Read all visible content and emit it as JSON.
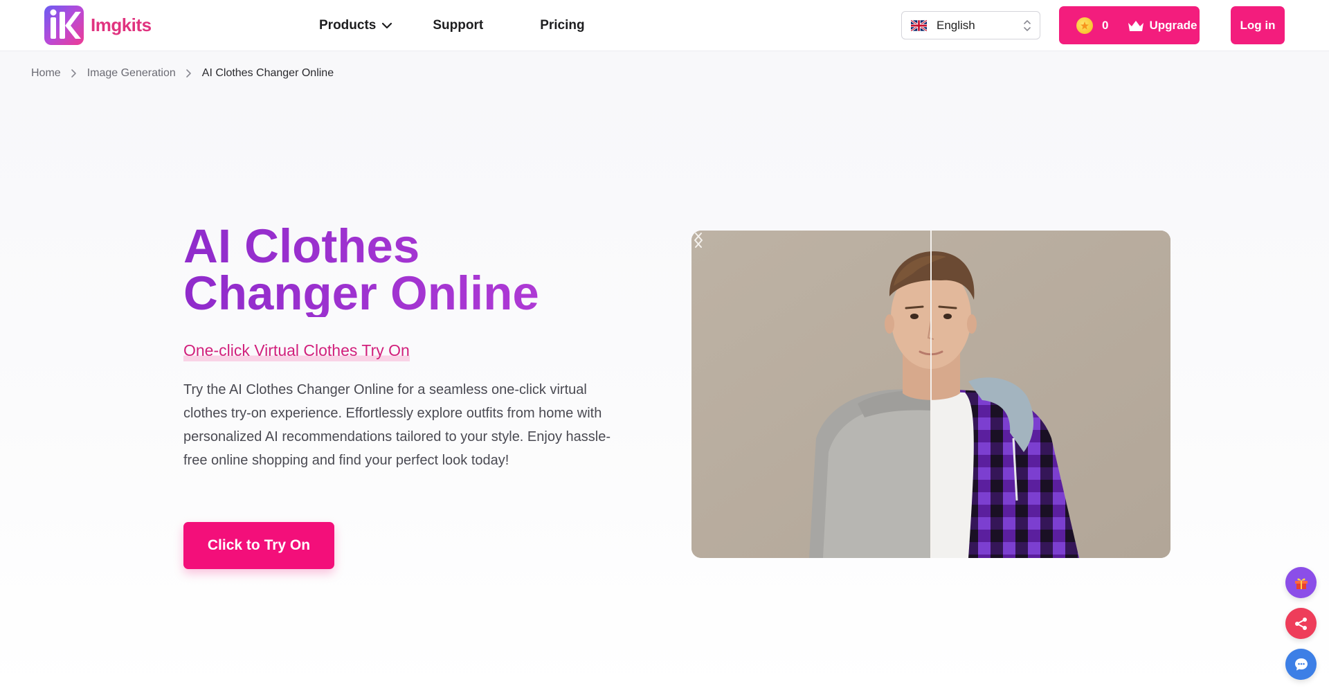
{
  "header": {
    "brand": "Imgkits",
    "nav": {
      "products": "Products",
      "support": "Support",
      "pricing": "Pricing"
    },
    "language": {
      "selected": "English",
      "flag_icon": "uk-flag-icon"
    },
    "credits": {
      "count": "0",
      "upgrade_label": "Upgrade"
    },
    "login_label": "Log in"
  },
  "breadcrumb": {
    "items": [
      "Home",
      "Image Generation"
    ],
    "current": "AI Clothes Changer Online"
  },
  "hero": {
    "title_line1": "AI Clothes",
    "title_line2": "Changer Online",
    "subtitle": "One-click Virtual Clothes Try On",
    "description": "Try the AI Clothes Changer Online for a seamless one-click virtual clothes try-on experience. Effortlessly explore outfits from home with personalized AI recommendations tailored to your style. Enjoy hassle-free online shopping and find your perfect look today!",
    "cta_label": "Click to Try On"
  },
  "compare": {
    "before_image": "man-gray-sweater",
    "after_image": "man-purple-plaid-hoodie"
  },
  "floating": [
    "gift-icon",
    "share-icon",
    "chat-icon"
  ],
  "colors": {
    "brand_pink": "#f31d7d",
    "title_purple": "#9b32cf",
    "subtitle_pink": "#d11f7c"
  }
}
